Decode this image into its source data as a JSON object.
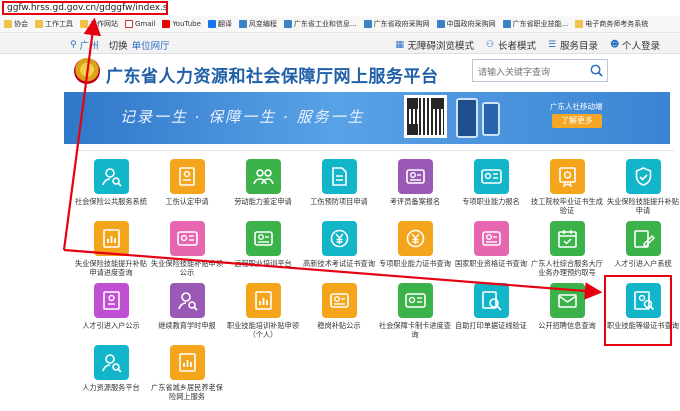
{
  "browser": {
    "url": "ggfw.hrss.gd.gov.cn/gdggfw/index.shtml",
    "bookmarks": [
      {
        "label": "协会",
        "icon": "folder-icon"
      },
      {
        "label": "工作工具",
        "icon": "folder-icon"
      },
      {
        "label": "工作网站",
        "icon": "folder-icon"
      },
      {
        "label": "Gmail",
        "icon": "gmail-icon"
      },
      {
        "label": "YouTube",
        "icon": "youtube-icon"
      },
      {
        "label": "翻译",
        "icon": "translate-icon"
      },
      {
        "label": "风变编程",
        "icon": "globe-icon"
      },
      {
        "label": "广东省工业和信息...",
        "icon": "globe-icon"
      },
      {
        "label": "广东省政府采购网",
        "icon": "globe-icon"
      },
      {
        "label": "中国政府采购网",
        "icon": "globe-icon"
      },
      {
        "label": "广东省职业技能...",
        "icon": "globe-icon"
      },
      {
        "label": "电子商务师考务系统",
        "icon": "folder-icon"
      }
    ]
  },
  "topnav": {
    "city": "广州",
    "switch": "切换",
    "unit": "单位网厅",
    "links": [
      "无障碍浏览模式",
      "长者模式",
      "服务目录",
      "个人登录"
    ]
  },
  "header": {
    "title": "广东省人力资源和社会保障厅网上服务平台",
    "search_placeholder": "请输入关键字查询"
  },
  "banner": {
    "slogan": "记录一生 · 保障一生 · 服务一生",
    "caption": "广东人社移动端",
    "button": "了解更多"
  },
  "colors": {
    "blue": "#1f5fa8",
    "red_highlight": "#e60012",
    "cyan": "#13b5c8",
    "green": "#3cb34a",
    "orange": "#f4a51c",
    "purple": "#9b59b6",
    "pink": "#e667b0",
    "magenta": "#c14fd4"
  },
  "services": [
    {
      "label": "社会保险公共服务系统",
      "color": "#13b5c8",
      "icon": "person-search-icon"
    },
    {
      "label": "工伤认定申请",
      "color": "#f4a51c",
      "icon": "person-doc-icon"
    },
    {
      "label": "劳动能力鉴定申请",
      "color": "#3cb34a",
      "icon": "people-icon"
    },
    {
      "label": "工伤预防项目申请",
      "color": "#13b5c8",
      "icon": "document-icon"
    },
    {
      "label": "考评员备案报名",
      "color": "#9b59b6",
      "icon": "person-card-icon"
    },
    {
      "label": "专项职业能力报名",
      "color": "#13b5c8",
      "icon": "id-card-icon"
    },
    {
      "label": "技工院校毕业证书生成验证",
      "color": "#f4a51c",
      "icon": "certificate-icon"
    },
    {
      "label": "失业保险技能提升补贴申请",
      "color": "#13b5c8",
      "icon": "shield-icon"
    },
    {
      "label": "失业保险技能提升补贴申请进度查询",
      "color": "#f4a51c",
      "icon": "report-icon"
    },
    {
      "label": "失业保险技能补贴申领公示",
      "color": "#e667b0",
      "icon": "id-card-icon"
    },
    {
      "label": "远程职业培训平台",
      "color": "#3cb34a",
      "icon": "person-card-icon"
    },
    {
      "label": "高新技术考试证书查询",
      "color": "#13b5c8",
      "icon": "coin-icon"
    },
    {
      "label": "专项职业能力证书查询",
      "color": "#f4a51c",
      "icon": "coin-icon"
    },
    {
      "label": "国家职业资格证书查询",
      "color": "#e667b0",
      "icon": "person-card-icon"
    },
    {
      "label": "广东人社综合服务大厅业务办理预约取号",
      "color": "#3cb34a",
      "icon": "calendar-icon"
    },
    {
      "label": "人才引进入户系统",
      "color": "#3cb34a",
      "icon": "edit-icon"
    },
    {
      "label": "人才引进入户公示",
      "color": "#c14fd4",
      "icon": "notice-icon"
    },
    {
      "label": "继续教育学时申报",
      "color": "#9b59b6",
      "icon": "person-search-icon"
    },
    {
      "label": "职业技能培训补贴申领（个人）",
      "color": "#f4a51c",
      "icon": "report-icon"
    },
    {
      "label": "稳岗补贴公示",
      "color": "#f4a51c",
      "icon": "person-card-icon"
    },
    {
      "label": "社会保障卡制卡进度查询",
      "color": "#3cb34a",
      "icon": "id-card-icon"
    },
    {
      "label": "自助打印单据证线验证",
      "color": "#13b5c8",
      "icon": "magnify-icon"
    },
    {
      "label": "公开招聘信息查询",
      "color": "#3cb34a",
      "icon": "mail-icon"
    },
    {
      "label": "职业技能等级证书查询",
      "color": "#13b5c8",
      "icon": "certificate-search-icon"
    },
    {
      "label": "人力资源服务平台",
      "color": "#13b5c8",
      "icon": "person-search-icon"
    },
    {
      "label": "广东省城乡居民养老保险网上服务",
      "color": "#f4a51c",
      "icon": "report-icon"
    }
  ]
}
